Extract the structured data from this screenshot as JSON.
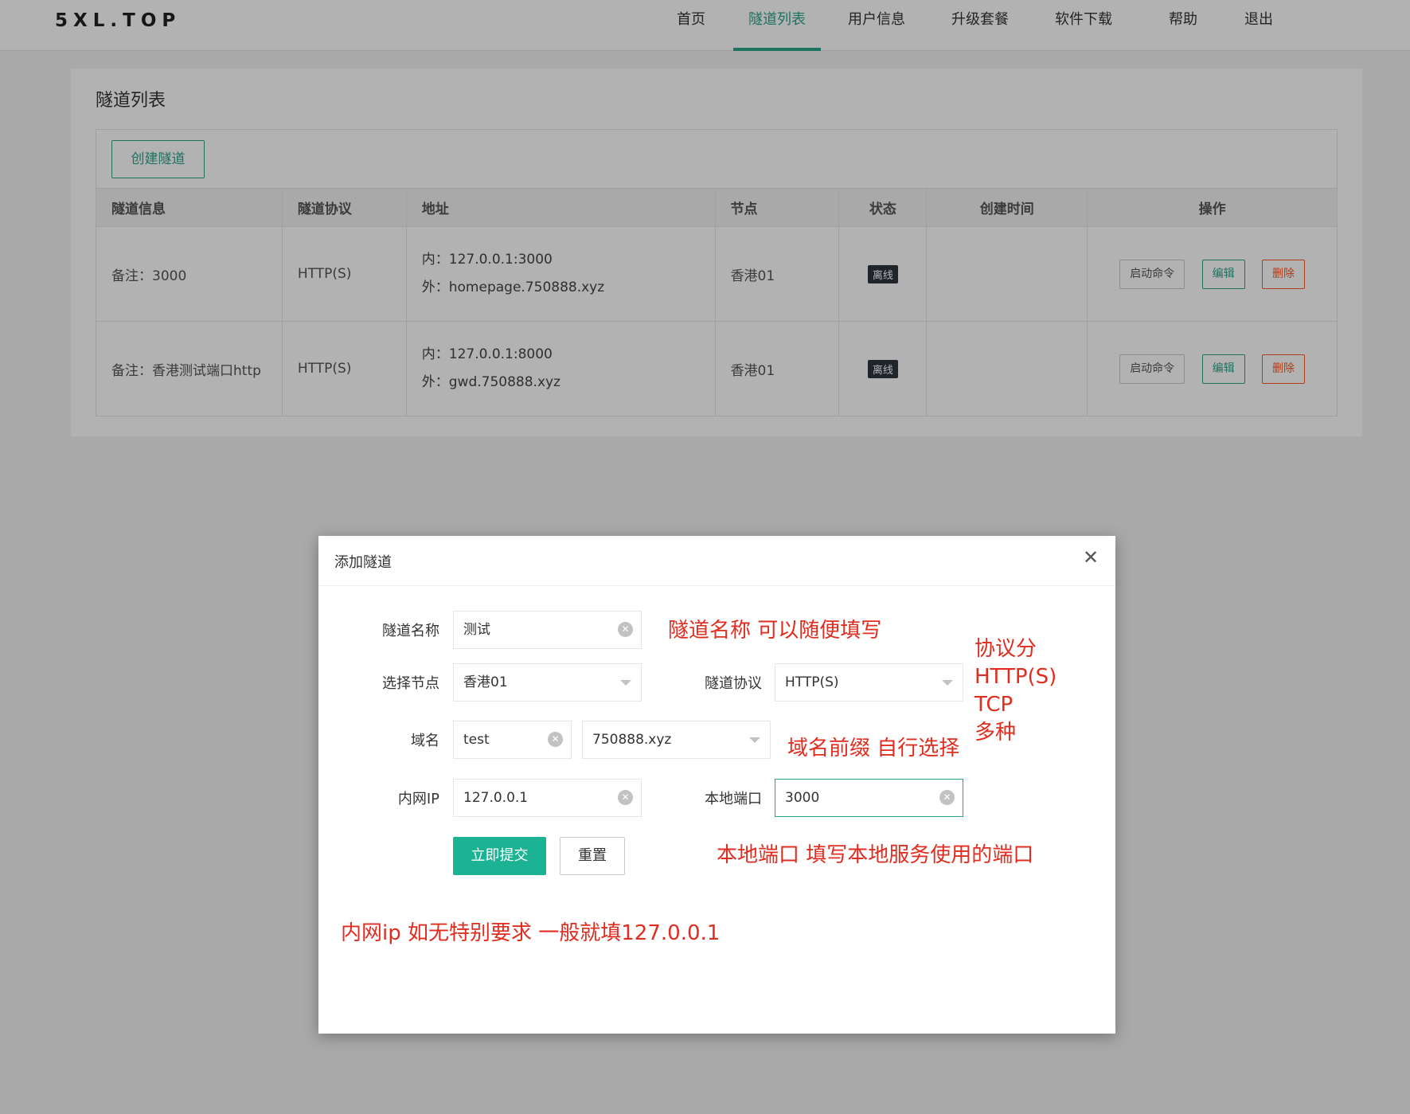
{
  "header": {
    "logo": "5XL.TOP",
    "nav": [
      {
        "label": "首页",
        "active": false
      },
      {
        "label": "隧道列表",
        "active": true
      },
      {
        "label": "用户信息",
        "active": false
      },
      {
        "label": "升级套餐",
        "active": false
      },
      {
        "label": "软件下载",
        "active": false
      },
      {
        "label": "帮助",
        "active": false
      },
      {
        "label": "退出",
        "active": false
      }
    ],
    "accent": "#2aa58a"
  },
  "card": {
    "title": "隧道列表",
    "create_button": "创建隧道",
    "columns": [
      "隧道信息",
      "隧道协议",
      "地址",
      "节点",
      "状态",
      "创建时间",
      "操作"
    ],
    "rows": [
      {
        "info": "备注：3000",
        "protocol": "HTTP(S)",
        "inner": "内：127.0.0.1:3000",
        "outer": "外：homepage.750888.xyz",
        "node": "香港01",
        "status": "离线",
        "created": "",
        "actions": {
          "cmd": "启动命令",
          "edit": "编辑",
          "delete": "删除"
        }
      },
      {
        "info": "备注：香港测试端口http",
        "protocol": "HTTP(S)",
        "inner": "内：127.0.0.1:8000",
        "outer": "外：gwd.750888.xyz",
        "node": "香港01",
        "status": "离线",
        "created": "",
        "actions": {
          "cmd": "启动命令",
          "edit": "编辑",
          "delete": "删除"
        }
      }
    ]
  },
  "modal": {
    "title": "添加隧道",
    "close_icon": "close-icon",
    "fields": {
      "name_label": "隧道名称",
      "name_value": "测试",
      "node_label": "选择节点",
      "node_value": "香港01",
      "protocol_label": "隧道协议",
      "protocol_value": "HTTP(S)",
      "domain_label": "域名",
      "domain_prefix": "test",
      "domain_suffix": "750888.xyz",
      "ip_label": "内网IP",
      "ip_value": "127.0.0.1",
      "port_label": "本地端口",
      "port_value": "3000"
    },
    "submit": "立即提交",
    "reset": "重置"
  },
  "annotations": {
    "color": "#e02d20",
    "name_note": "隧道名称 可以随便填写",
    "protocol_note": "协议分\nHTTP(S)\nTCP\n多种",
    "domain_note": "域名前缀 自行选择",
    "port_note": "本地端口 填写本地服务使用的端口",
    "ip_note": "内网ip 如无特别要求 一般就填127.0.0.1"
  }
}
